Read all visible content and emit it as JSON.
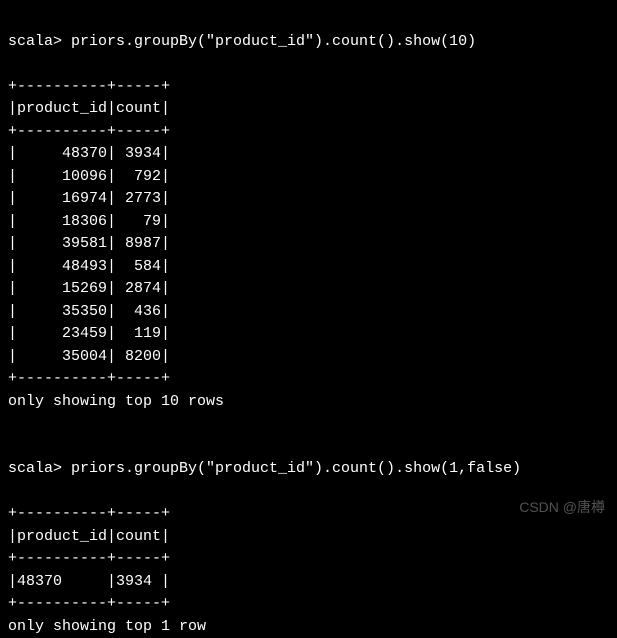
{
  "chart_data": [
    {
      "type": "table",
      "title": "priors groupBy product_id count (top 10)",
      "columns": [
        "product_id",
        "count"
      ],
      "rows": [
        [
          48370,
          3934
        ],
        [
          10096,
          792
        ],
        [
          16974,
          2773
        ],
        [
          18306,
          79
        ],
        [
          39581,
          8987
        ],
        [
          48493,
          584
        ],
        [
          15269,
          2874
        ],
        [
          35350,
          436
        ],
        [
          23459,
          119
        ],
        [
          35004,
          8200
        ]
      ]
    },
    {
      "type": "table",
      "title": "priors groupBy product_id count (top 1, no truncate)",
      "columns": [
        "product_id",
        "count"
      ],
      "rows": [
        [
          48370,
          3934
        ]
      ]
    }
  ],
  "prompt1": "scala> priors.groupBy(\"product_id\").count().show(10)",
  "table1": {
    "border": "+----------+-----+",
    "header": "|product_id|count|",
    "rows": [
      "|     48370| 3934|",
      "|     10096|  792|",
      "|     16974| 2773|",
      "|     18306|   79|",
      "|     39581| 8987|",
      "|     48493|  584|",
      "|     15269| 2874|",
      "|     35350|  436|",
      "|     23459|  119|",
      "|     35004| 8200|"
    ],
    "footer": "only showing top 10 rows"
  },
  "prompt2": "scala> priors.groupBy(\"product_id\").count().show(1,false)",
  "table2": {
    "border": "+----------+-----+",
    "header": "|product_id|count|",
    "rows": [
      "|48370     |3934 |"
    ],
    "footer": "only showing top 1 row"
  },
  "watermark": "CSDN @唐樽"
}
